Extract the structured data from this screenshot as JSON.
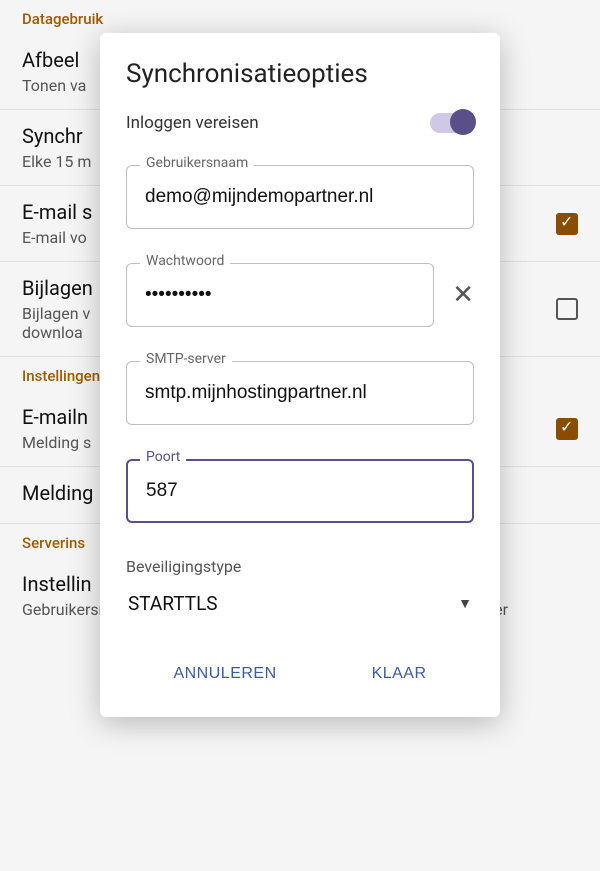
{
  "bg": {
    "section1": "Datagebruik",
    "row1_title": "Afbeel",
    "row1_sub": "Tonen va",
    "row2_title": "Synchr",
    "row2_sub": "Elke 15 m",
    "row3_title": "E-mail s",
    "row3_sub": "E-mail vo",
    "row4_title": "Bijlagen",
    "row4_sub": "Bijlagen v\ndownloa",
    "section2": "Instellingen",
    "row5_title": "E-mailn",
    "row5_sub": "Melding s",
    "row6_title": "Melding",
    "section3": "Serverins",
    "row7_title": "Instellin",
    "row7_sub": "Gebruikersnaam, wachtwoord en andere inst. voor inkomende server"
  },
  "dialog": {
    "title": "Synchronisatieopties",
    "toggle_label": "Inloggen vereisen",
    "username_label": "Gebruikersnaam",
    "username_value": "demo@mijndemopartner.nl",
    "password_label": "Wachtwoord",
    "password_value": "••••••••••",
    "smtp_label": "SMTP-server",
    "smtp_value": "smtp.mijnhostingpartner.nl",
    "port_label": "Poort",
    "port_value": "587",
    "security_label": "Beveiligingstype",
    "security_value": "STARTTLS",
    "cancel": "Annuleren",
    "done": "Klaar"
  }
}
